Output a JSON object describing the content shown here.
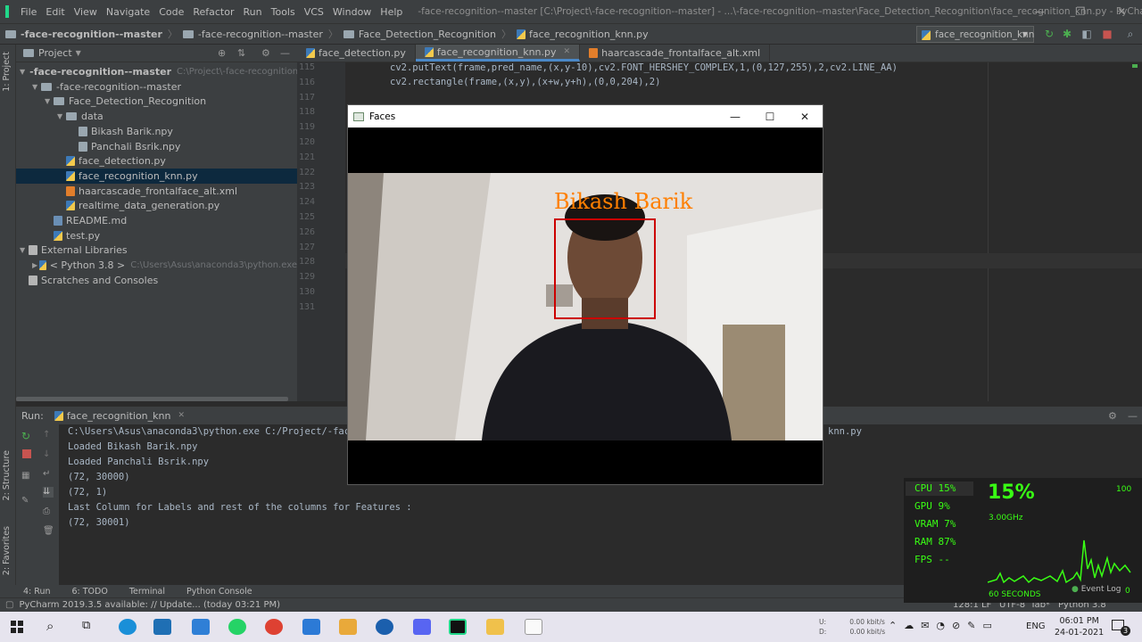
{
  "menu": [
    "File",
    "Edit",
    "View",
    "Navigate",
    "Code",
    "Refactor",
    "Run",
    "Tools",
    "VCS",
    "Window",
    "Help"
  ],
  "window_title": "-face-recognition--master [C:\\Project\\-face-recognition--master] - ...\\-face-recognition--master\\Face_Detection_Recognition\\face_recognition_knn.py - PyCharm",
  "breadcrumbs": [
    "-face-recognition--master",
    "-face-recognition--master",
    "Face_Detection_Recognition",
    "face_recognition_knn.py"
  ],
  "run_config": "face_recognition_knn",
  "left_strip_tabs": [
    "1: Project",
    "2: Structure",
    "2: Favorites"
  ],
  "project": {
    "header": "Project",
    "tree": [
      {
        "label": "-face-recognition--master",
        "extra": "C:\\Project\\-face-recognition--maste",
        "type": "folder",
        "arrow": "▼",
        "indent": 0
      },
      {
        "label": "-face-recognition--master",
        "type": "folder",
        "arrow": "▼",
        "indent": 1
      },
      {
        "label": "Face_Detection_Recognition",
        "type": "folder",
        "arrow": "▼",
        "indent": 2
      },
      {
        "label": "data",
        "type": "folder",
        "arrow": "▼",
        "indent": 3
      },
      {
        "label": "Bikash Barik.npy",
        "type": "npy",
        "arrow": "",
        "indent": 4
      },
      {
        "label": "Panchali Bsrik.npy",
        "type": "npy",
        "arrow": "",
        "indent": 4
      },
      {
        "label": "face_detection.py",
        "type": "py",
        "arrow": "",
        "indent": 3
      },
      {
        "label": "face_recognition_knn.py",
        "type": "py",
        "arrow": "",
        "indent": 3,
        "selected": true
      },
      {
        "label": "haarcascade_frontalface_alt.xml",
        "type": "xml",
        "arrow": "",
        "indent": 3
      },
      {
        "label": "realtime_data_generation.py",
        "type": "py",
        "arrow": "",
        "indent": 3
      },
      {
        "label": "README.md",
        "type": "md",
        "arrow": "",
        "indent": 2
      },
      {
        "label": "test.py",
        "type": "py",
        "arrow": "",
        "indent": 2
      },
      {
        "label": "External Libraries",
        "type": "lib",
        "arrow": "▼",
        "indent": 0
      },
      {
        "label": "< Python 3.8 >",
        "extra": "C:\\Users\\Asus\\anaconda3\\python.exe",
        "type": "py",
        "arrow": "▶",
        "indent": 1
      },
      {
        "label": "Scratches and Consoles",
        "type": "lib",
        "arrow": "",
        "indent": 0
      }
    ]
  },
  "editor": {
    "tabs": [
      {
        "label": "face_detection.py",
        "active": false
      },
      {
        "label": "face_recognition_knn.py",
        "active": true
      },
      {
        "label": "haarcascade_frontalface_alt.xml",
        "active": false
      }
    ],
    "line_numbers": [
      "115",
      "116",
      "117",
      "118",
      "119",
      "120",
      "121",
      "122",
      "123",
      "124",
      "125",
      "126",
      "127",
      "128",
      "129",
      "130",
      "131"
    ],
    "code_lines": [
      "cv2.putText(frame,pred_name,(x,y-10),cv2.FONT_HERSHEY_COMPLEX,1,(0,127,255),2,cv2.LINE_AA)",
      "cv2.rectangle(frame,(x,y),(x+w,y+h),(0,0,204),2)"
    ]
  },
  "run": {
    "label": "Run:",
    "tab": "face_recognition_knn",
    "console": [
      "C:\\Users\\Asus\\anaconda3\\python.exe C:/Project/-face-",
      "Loaded Bikash Barik.npy",
      "Loaded Panchali Bsrik.npy",
      "(72, 30000)",
      "(72, 1)",
      "Last Column for Labels and rest of the columns for Features :",
      "(72, 30001)"
    ],
    "console_tail": "knn.py"
  },
  "bottom_tabs": [
    "4: Run",
    "6: TODO",
    "Terminal",
    "Python Console"
  ],
  "status": {
    "message": "PyCharm 2019.3.5 available: // Update... (today 03:21 PM)",
    "position": "128:1",
    "line_sep": "LF",
    "encoding": "UTF-8",
    "indent": "Tab*",
    "interpreter": "Python 3.8",
    "event_log": "Event Log",
    "event_count": "0"
  },
  "faces_window": {
    "title": "Faces",
    "label": "Bikash Barik",
    "label_color": "#ff7f00",
    "box_color": "#cc0000"
  },
  "monitor": {
    "cpu": "CPU  15%",
    "gpu": "GPU  9%",
    "vram": "VRAM  7%",
    "ram": "RAM  87%",
    "fps": "FPS  --",
    "big_percent": "15%",
    "freq": "3.00GHz",
    "max": "100",
    "window": "60 SECONDS"
  },
  "taskbar": {
    "net_up_label": "U:",
    "net_up": "0.00 kbit/s",
    "net_down_label": "D:",
    "net_down": "0.00 kbit/s",
    "lang": "ENG",
    "time": "06:01 PM",
    "date": "24-01-2021",
    "notif_count": "3"
  },
  "colors": {
    "accent": "#4a88c7",
    "monitor_green": "#39ff14"
  }
}
